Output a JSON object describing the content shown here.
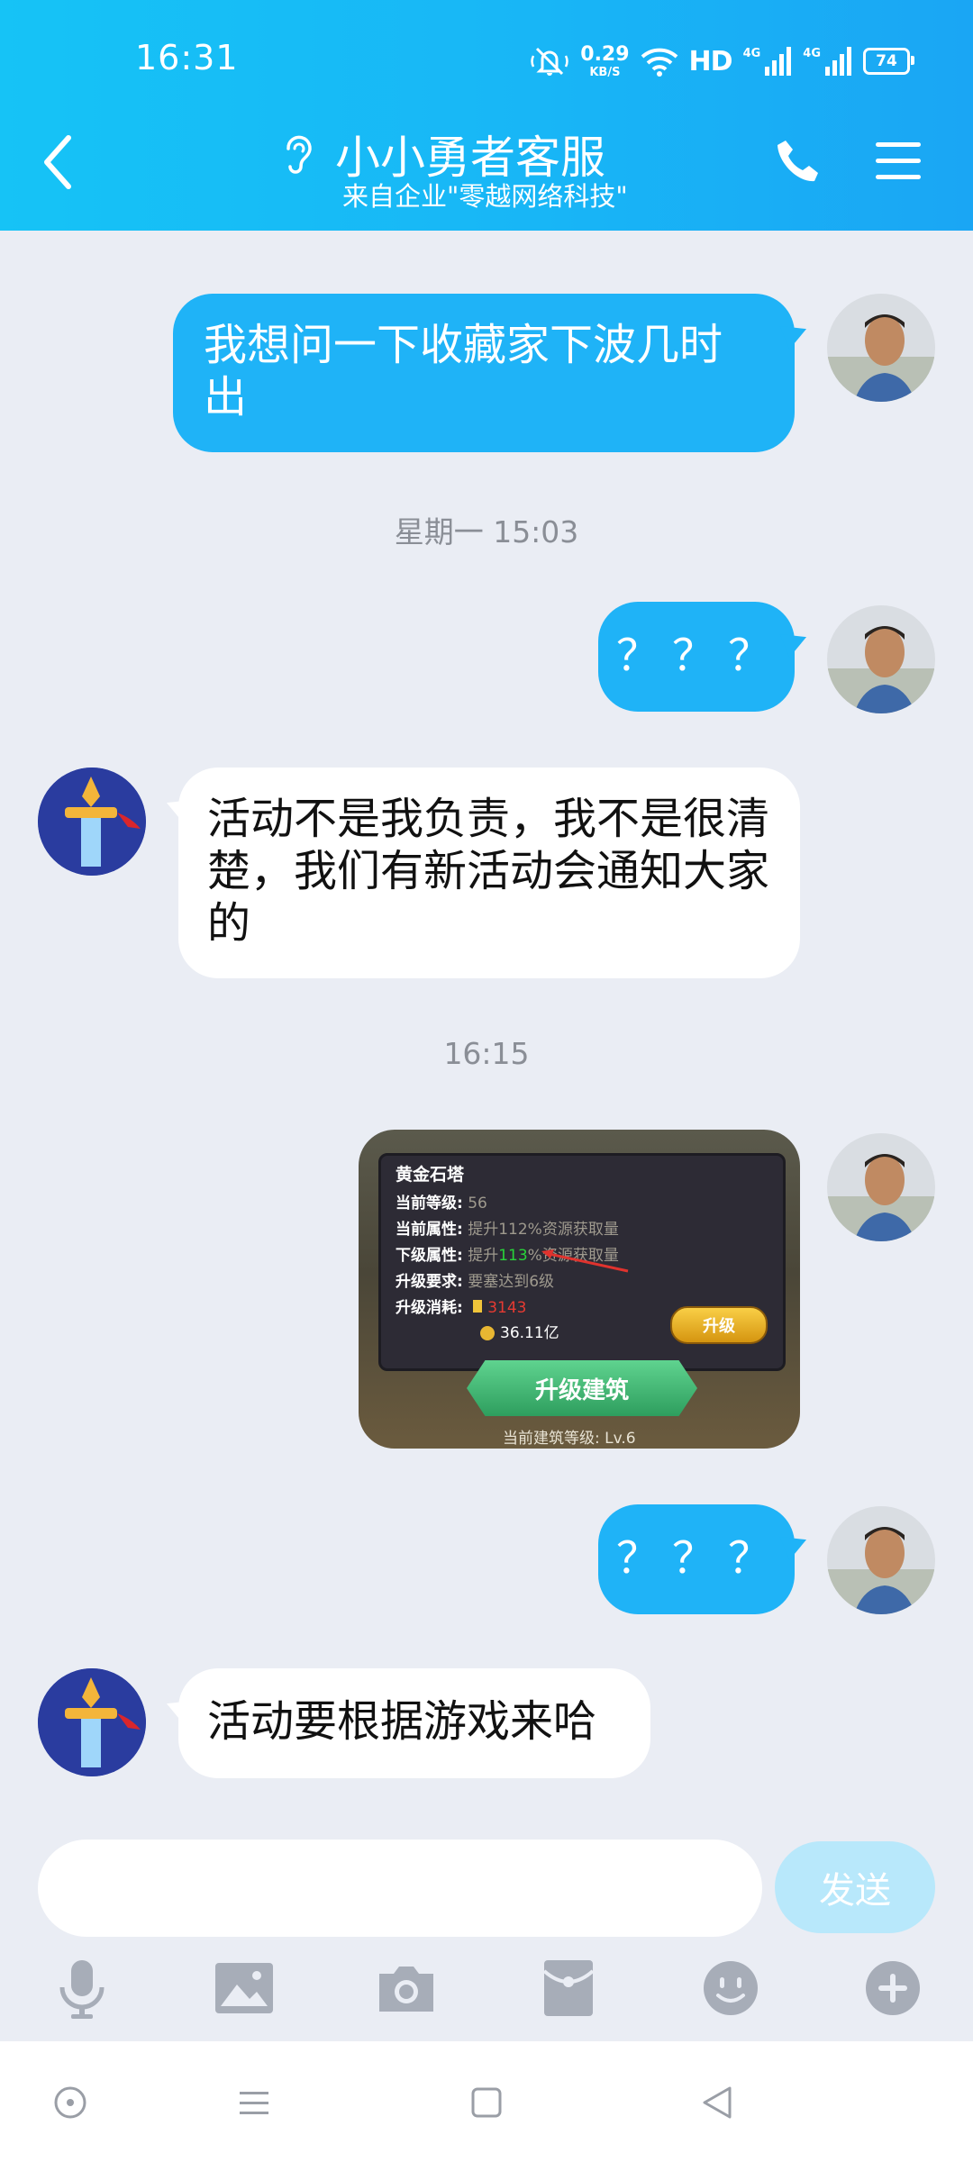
{
  "status_bar": {
    "time": "16:31",
    "net_speed_value": "0.29",
    "net_speed_unit": "KB/S",
    "hd_label": "HD",
    "sig1_tag": "4G",
    "sig2_tag": "4G",
    "battery": "74"
  },
  "header": {
    "title": "小小勇者客服",
    "subtitle": "来自企业\"零越网络科技\""
  },
  "messages": [
    {
      "text": "我想问一下收藏家下波几时出"
    },
    {
      "timestamp": "星期一 15:03"
    },
    {
      "text": "？？？"
    },
    {
      "text": "活动不是我负责，我不是很清楚，我们有新活动会通知大家的"
    },
    {
      "timestamp": "16:15"
    },
    {
      "image": {
        "title": "黄金石塔",
        "row1_key": "当前等级:",
        "row1_val": "56",
        "row2_key": "当前属性:",
        "row2_val": "提升112%资源获取量",
        "row3_key": "下级属性:",
        "row3_pre": "提升",
        "row3_num": "113",
        "row3_post": "%资源获取量",
        "row4_key": "升级要求:",
        "row4_val": "要塞达到6级",
        "row5_key": "升级消耗:",
        "row5_val": "3143",
        "row6_val": "36.11亿",
        "upgrade_btn": "升级",
        "build_btn": "升级建筑",
        "bottom_text": "当前建筑等级: Lv.6"
      }
    },
    {
      "text": "？？？"
    },
    {
      "text": "活动要根据游戏来哈"
    }
  ],
  "input": {
    "placeholder": "",
    "send_label": "发送"
  },
  "toolbar": {
    "icons": [
      "microphone-icon",
      "image-icon",
      "camera-icon",
      "red-packet-icon",
      "emoji-icon",
      "plus-icon"
    ]
  },
  "colors": {
    "header_start": "#16C3F6",
    "header_end": "#1AA6F4",
    "outgoing_bubble": "#1FB3F7",
    "incoming_bubble": "#FFFFFF",
    "chat_bg": "#EAEDF4",
    "send_disabled": "#B8E8FB"
  }
}
